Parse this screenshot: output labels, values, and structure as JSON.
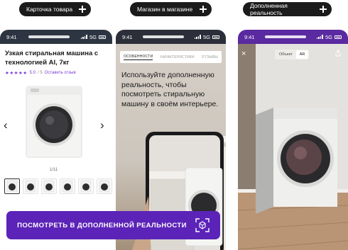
{
  "pills": [
    {
      "label": "Карточка товара"
    },
    {
      "label": "Магазин в магазине"
    },
    {
      "label": "Дополненная реальность"
    }
  ],
  "status_time": "9:41",
  "status_network": "5G",
  "product": {
    "title": "Узкая стиральная машина с технологией AI, 7кг",
    "rating_stars": "★★★★★",
    "rating_value": "5.0",
    "rating_scale": "/ 5",
    "review_link": "Оставить отзыв",
    "pager": "1/11",
    "thumbnail_count": 6
  },
  "ar_info": {
    "tabs": [
      "ОСОБЕННОСТИ",
      "ХАРАКТЕРИСТИКИ",
      "ОТЗЫВЫ"
    ],
    "active_tab": 0,
    "text": "Используйте дополненную реальность, чтобы посмотреть стиральную машину в своём интерьере."
  },
  "ar_view": {
    "toggle": [
      "Объект",
      "AR"
    ],
    "active_toggle": 1,
    "close_icon": "close-icon",
    "share_icon": "share-icon"
  },
  "cta": {
    "label": "ПОСМОТРЕТЬ В ДОПОЛНЕННОЙ РЕАЛЬНОСТИ",
    "icon": "ar-scan-icon"
  },
  "colors": {
    "accent": "#5c23b8",
    "dark": "#1b1b1b"
  }
}
